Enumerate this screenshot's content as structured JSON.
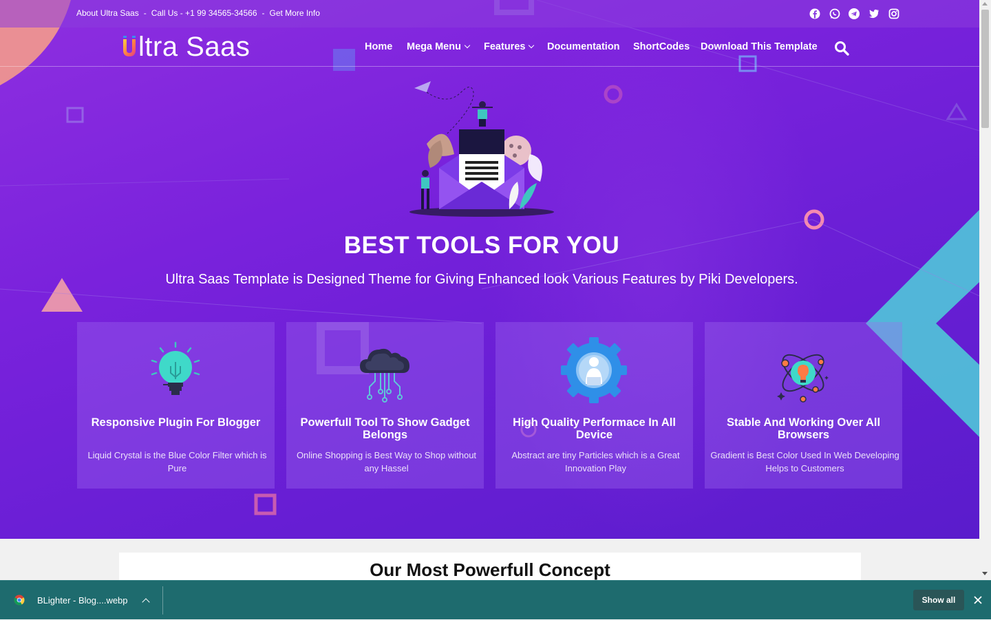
{
  "topbar": {
    "links": [
      "About Ultra Saas",
      "Call Us - +1 99 34565-34566",
      "Get More Info"
    ],
    "separator": "-",
    "social_icons": [
      "facebook-icon",
      "whatsapp-icon",
      "telegram-icon",
      "twitter-icon",
      "instagram-icon"
    ]
  },
  "nav": {
    "logo_text": "ltra Saas",
    "logo_letter": "U",
    "items": [
      {
        "label": "Home",
        "has_dropdown": false
      },
      {
        "label": "Mega Menu",
        "has_dropdown": true
      },
      {
        "label": "Features",
        "has_dropdown": true
      },
      {
        "label": "Documentation",
        "has_dropdown": false
      },
      {
        "label": "ShortCodes",
        "has_dropdown": false
      },
      {
        "label": "Download This Template",
        "has_dropdown": false
      }
    ],
    "search_icon": "search-icon"
  },
  "hero": {
    "title": "BEST TOOLS FOR YOU",
    "subtitle": "Ultra Saas Template is Designed Theme for Giving Enhanced look Various Features by Piki Developers.",
    "illustration": "envelope-illustration"
  },
  "cards": [
    {
      "icon": "lightbulb-icon",
      "title": "Responsive Plugin For Blogger",
      "desc": "Liquid Crystal is the Blue Color Filter which is Pure"
    },
    {
      "icon": "cloud-network-icon",
      "title": "Powerfull Tool To Show Gadget Belongs",
      "desc": "Online Shopping is Best Way to Shop without any Hassel"
    },
    {
      "icon": "gear-user-icon",
      "title": "High Quality Performace In All Device",
      "desc": "Abstract are tiny Particles which is a Great Innovation Play"
    },
    {
      "icon": "atom-bulb-icon",
      "title": "Stable And Working Over All Browsers",
      "desc": "Gradient is Best Color Used In Web Developing Helps to Customers"
    }
  ],
  "concept": {
    "title": "Our Most Powerfull Concept"
  },
  "download_bar": {
    "file_name": "BLighter - Blog....webp",
    "show_all": "Show all",
    "colors": {
      "bar": "#1e6b6e",
      "button": "#2a5557"
    }
  },
  "colors": {
    "hero_start": "#8e2fe0",
    "hero_end": "#5a1ccc",
    "accent_teal": "#4fd1d9"
  }
}
